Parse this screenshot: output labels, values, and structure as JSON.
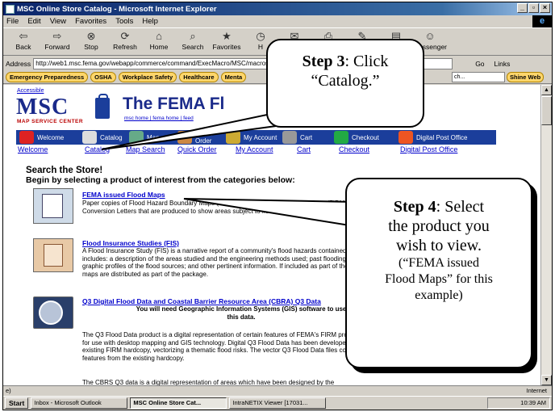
{
  "window": {
    "title": "MSC Online Store Catalog - Microsoft Internet Explorer",
    "buttons": [
      "_",
      "▫",
      "×"
    ]
  },
  "menu": [
    "File",
    "Edit",
    "View",
    "Favorites",
    "Tools",
    "Help"
  ],
  "toolbar": [
    {
      "label": "Back",
      "icon": "back-arrow-icon",
      "glyph": "⇦"
    },
    {
      "label": "Forward",
      "icon": "forward-arrow-icon",
      "glyph": "⇨"
    },
    {
      "label": "Stop",
      "icon": "stop-icon",
      "glyph": "⊗"
    },
    {
      "label": "Refresh",
      "icon": "refresh-icon",
      "glyph": "⟳"
    },
    {
      "label": "Home",
      "icon": "home-icon",
      "glyph": "⌂"
    },
    {
      "label": "Search",
      "icon": "search-icon",
      "glyph": "⌕"
    },
    {
      "label": "Favorites",
      "icon": "favorites-icon",
      "glyph": "★"
    },
    {
      "label": "H",
      "icon": "history-icon",
      "glyph": "◷"
    },
    {
      "label": "",
      "icon": "mail-icon",
      "glyph": "✉"
    },
    {
      "label": "",
      "icon": "print-icon",
      "glyph": "⎙"
    },
    {
      "label": "",
      "icon": "edit-icon",
      "glyph": "✎"
    },
    {
      "label": "",
      "icon": "discuss-icon",
      "glyph": "▤"
    },
    {
      "label": "Messenger",
      "icon": "messenger-icon",
      "glyph": "☺"
    }
  ],
  "address": {
    "label": "Address",
    "url": "http://web1.msc.fema.gov/webapp/commerce/command/ExecMacro/MSC/macros",
    "go": "Go",
    "links": "Links"
  },
  "links_bar": {
    "items": [
      "Emergency Preparedness",
      "OSHA",
      "Workplace Safety",
      "Healthcare",
      "Menta"
    ],
    "search_placeholder": "ch...",
    "shine": "Shine Web"
  },
  "page": {
    "accessible": "Accessible",
    "logo": "MSC",
    "logo_sub": "MAP SERVICE CENTER",
    "title": "The FEMA Fl",
    "mini_links": "msc home | fema home | feed",
    "nav_images": [
      "Welcome",
      "Catalog",
      "Map",
      "Quick Order",
      "My Account",
      "Cart",
      "Checkout",
      "Digital Post Office"
    ],
    "nav_links": [
      "Welcome",
      "Catalog",
      "Map Search",
      "Quick Order",
      "My Account",
      "Cart",
      "Checkout",
      "Digital Post Office"
    ],
    "search_heading": "Search the Store!",
    "begin_text": "Begin by selecting a product of interest from the categories below:",
    "products": [
      {
        "title": "FEMA issued Flood Maps",
        "desc": "Paper copies of Flood Hazard Boundary Maps (FHBMs), Flood Insurance Rate Maps (FIRMs) and Conversion Letters that are produced to show areas subject to flooding. They include accu"
      },
      {
        "title": "Flood Insurance Studies (FIS)",
        "desc": "A Flood Insurance Study (FIS) is a narrative report of a community's flood hazards contained in the FIS includes: a description of the areas studied and the engineering methods used; past flooding information; graphic profiles of the flood sources; and other pertinent information. If included as part of the study, floodway maps are distributed as part of the package."
      },
      {
        "title": "Q3 Digital Flood Data and Coastal Barrier Resource Area (CBRA) Q3 Data",
        "note": "You will need Geographic Information Systems (GIS) software to use this data.",
        "desc": "The Q3 Flood Data product is a digital representation of certain features of FEMA's FIRM product, intended for use with desktop mapping and GIS technology. Digital Q3 Flood Data has been developed by scanning the existing FIRM hardcopy, vectorizing a thematic flood risks. The vector Q3 Flood Data files contain only certain features from the existing hardcopy.",
        "desc2": "The CBRS Q3 data is a digital representation of areas which have been designed by the"
      }
    ]
  },
  "status": {
    "left": "e)",
    "zone": "Internet"
  },
  "taskbar": {
    "start": "Start",
    "tasks": [
      "Inbox - Microsoft Outlook",
      "MSC Online Store Cat...",
      "IntraNETIX Viewer [17031..."
    ],
    "clock": "10:39 AM"
  },
  "callouts": {
    "step3_bold": "Step 3",
    "step3_text": ": Click",
    "step3_line2": "“Catalog.”",
    "step4_bold": "Step 4",
    "step4_text": ": Select",
    "step4_line2": "the product you",
    "step4_line3": "wish to view.",
    "step4_small1": "(“FEMA issued",
    "step4_small2": "Flood Maps” for this",
    "step4_small3": "example)"
  }
}
